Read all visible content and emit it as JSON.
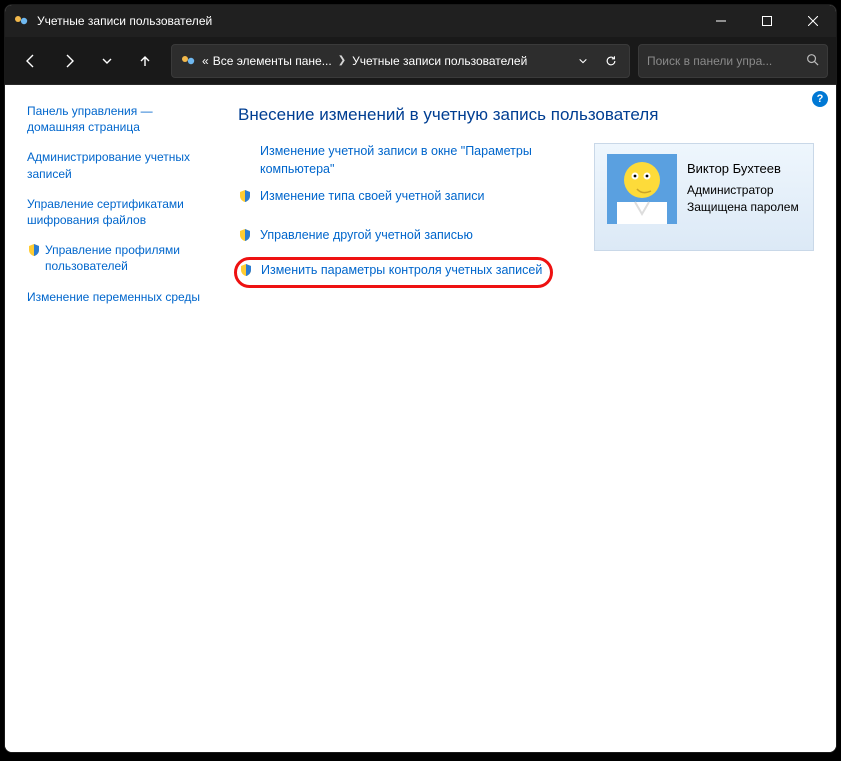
{
  "window": {
    "title": "Учетные записи пользователей"
  },
  "toolbar": {
    "breadcrumb_prefix": "«",
    "breadcrumb1": "Все элементы пане...",
    "breadcrumb2": "Учетные записи пользователей",
    "search_placeholder": "Поиск в панели упра..."
  },
  "sidebar": {
    "home1": "Панель управления —",
    "home2": "домашняя страница",
    "link_admin": "Администрирование учетных записей",
    "link_cert": "Управление сертификатами шифрования файлов",
    "link_profiles": "Управление профилями пользователей",
    "link_env": "Изменение переменных среды"
  },
  "main": {
    "heading": "Внесение изменений в учетную запись пользователя",
    "link_change_settings1": "Изменение учетной записи в окне \"Параметры",
    "link_change_settings2": "компьютера\"",
    "link_change_type": "Изменение типа своей учетной записи",
    "link_manage_other": "Управление другой учетной записью",
    "link_uac": "Изменить параметры контроля учетных записей"
  },
  "account": {
    "name": "Виктор Бухтеев",
    "role": "Администратор",
    "protection": "Защищена паролем"
  },
  "help": "?"
}
